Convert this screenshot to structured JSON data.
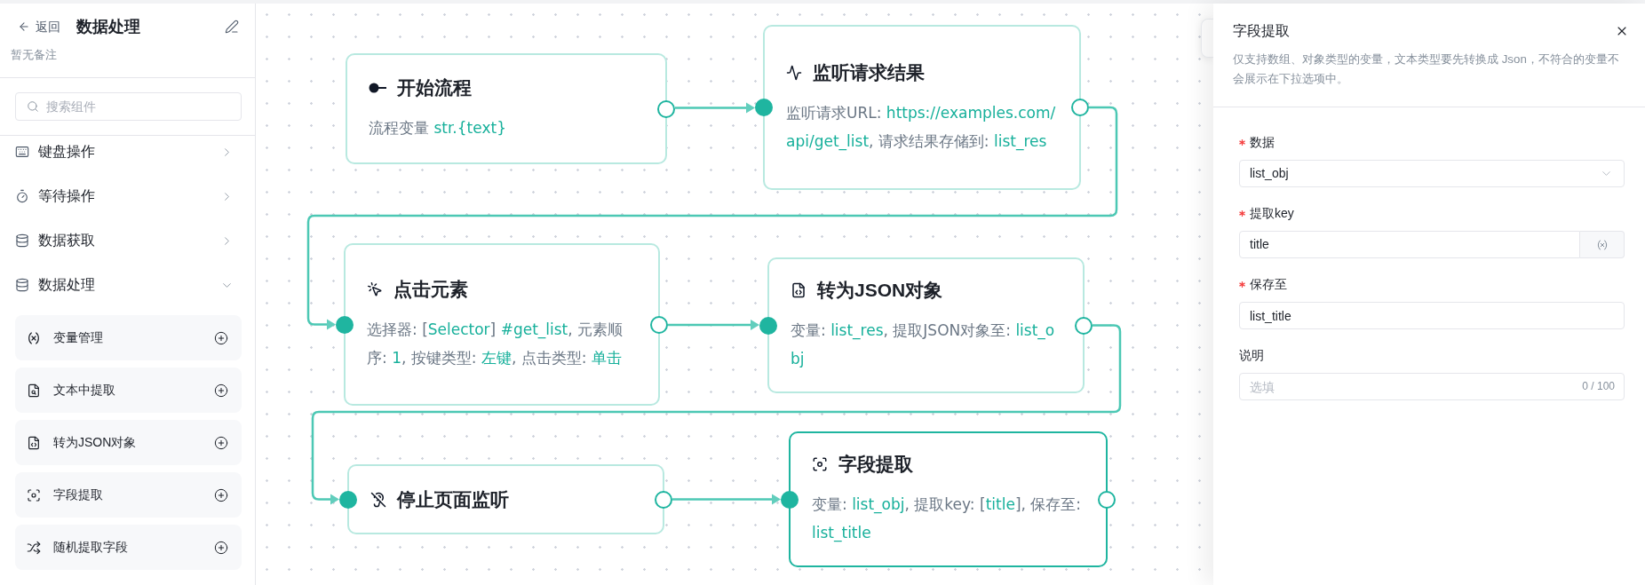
{
  "sidebar": {
    "back_label": "返回",
    "title": "数据处理",
    "note": "暂无备注",
    "search": {
      "placeholder": "搜索组件"
    },
    "categories": [
      {
        "label": "键盘操作",
        "expanded": false
      },
      {
        "label": "等待操作",
        "expanded": false
      },
      {
        "label": "数据获取",
        "expanded": false
      },
      {
        "label": "数据处理",
        "expanded": true,
        "children": [
          {
            "label": "变量管理"
          },
          {
            "label": "文本中提取"
          },
          {
            "label": "转为JSON对象"
          },
          {
            "label": "字段提取"
          },
          {
            "label": "随机提取字段"
          }
        ]
      }
    ]
  },
  "canvas": {
    "nodes": [
      {
        "title": "开始流程",
        "selected": false,
        "description": [
          {
            "kind": "label",
            "text": "流程变量 "
          },
          {
            "kind": "value",
            "text": "str.{text}"
          }
        ]
      },
      {
        "title": "监听请求结果",
        "selected": false,
        "description": [
          {
            "kind": "label",
            "text": "监听请求URL: "
          },
          {
            "kind": "value",
            "text": "https://examples.com/api/get_list"
          },
          {
            "kind": "label",
            "text": ", 请求结果存储到: "
          },
          {
            "kind": "value",
            "text": "list_res"
          }
        ]
      },
      {
        "title": "点击元素",
        "selected": false,
        "description": [
          {
            "kind": "label",
            "text": "选择器: ["
          },
          {
            "kind": "value",
            "text": "Selector"
          },
          {
            "kind": "label",
            "text": "] "
          },
          {
            "kind": "value",
            "text": "#get_list"
          },
          {
            "kind": "label",
            "text": ", 元素顺序: "
          },
          {
            "kind": "value",
            "text": "1"
          },
          {
            "kind": "label",
            "text": ", 按键类型: "
          },
          {
            "kind": "value",
            "text": "左键"
          },
          {
            "kind": "label",
            "text": ", 点击类型: "
          },
          {
            "kind": "value",
            "text": "单击"
          }
        ]
      },
      {
        "title": "转为JSON对象",
        "selected": false,
        "description": [
          {
            "kind": "label",
            "text": "变量: "
          },
          {
            "kind": "value",
            "text": "list_res"
          },
          {
            "kind": "label",
            "text": ", 提取JSON对象至: "
          },
          {
            "kind": "value",
            "text": "list_obj"
          }
        ]
      },
      {
        "title": "停止页面监听",
        "selected": false
      },
      {
        "title": "字段提取",
        "selected": true,
        "description": [
          {
            "kind": "label",
            "text": "变量: "
          },
          {
            "kind": "value",
            "text": "list_obj"
          },
          {
            "kind": "label",
            "text": ", 提取key: ["
          },
          {
            "kind": "value",
            "text": "title"
          },
          {
            "kind": "label",
            "text": "], 保存至: "
          },
          {
            "kind": "value",
            "text": "list_title"
          }
        ]
      }
    ]
  },
  "panel": {
    "title": "字段提取",
    "description": "仅支持数组、对象类型的变量，文本类型要先转换成 Json，不符合的变量不会展示在下拉选项中。",
    "fields": [
      {
        "kind": "select",
        "label": "数据",
        "required": true,
        "value": "list_obj"
      },
      {
        "kind": "variable_input",
        "label": "提取key",
        "required": true,
        "value": "title"
      },
      {
        "kind": "input",
        "label": "保存至",
        "required": true,
        "value": "list_title"
      },
      {
        "kind": "input",
        "label": "说明",
        "required": false,
        "placeholder": "选填",
        "counter": "0 / 100"
      }
    ]
  }
}
